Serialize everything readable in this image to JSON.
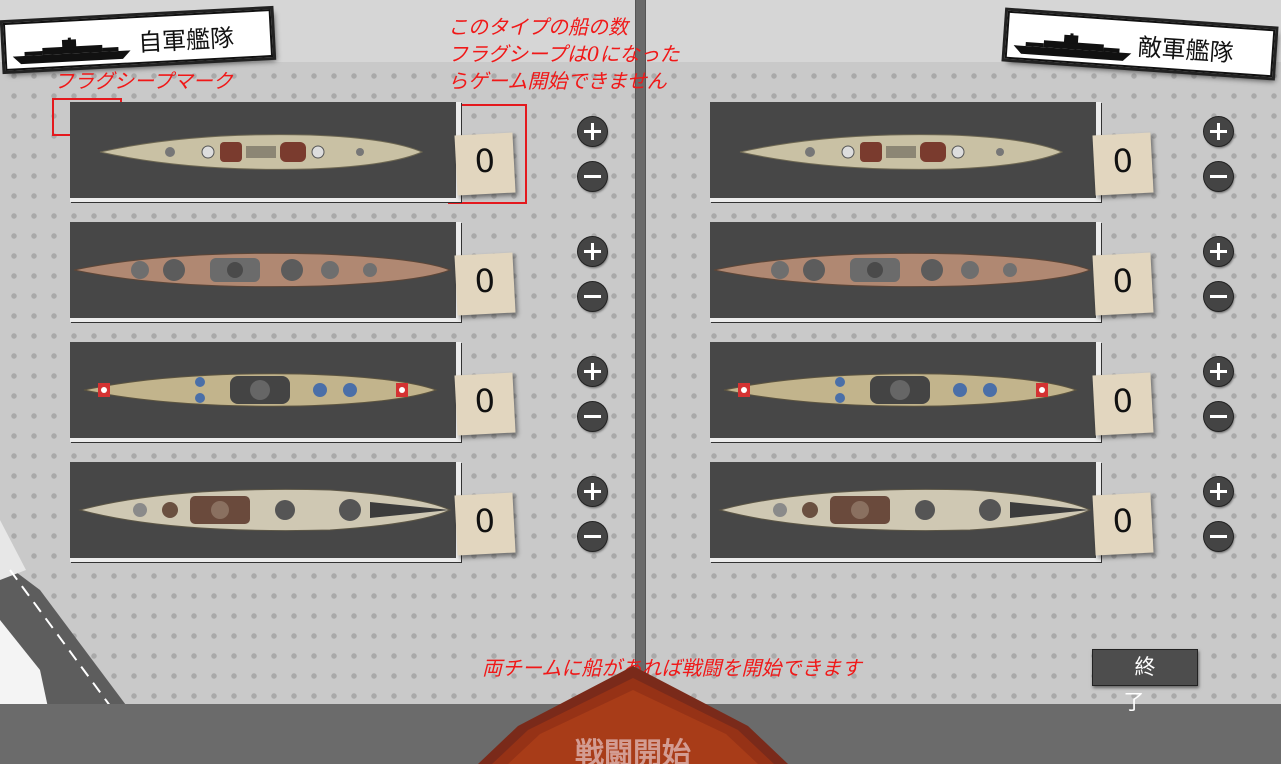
{
  "own_fleet": {
    "title": "自軍艦隊"
  },
  "enemy_fleet": {
    "title": "敵軍艦隊"
  },
  "annotations": {
    "flagship_mark": "フラグシープマーク",
    "count_note": [
      "このタイプの船の数",
      "フラグシープは0になった",
      "らゲーム開始できません"
    ],
    "start_note": "両チームに船があれば戦闘を開始できます"
  },
  "rows": [
    {
      "own_count": "0",
      "enemy_count": "0"
    },
    {
      "own_count": "0",
      "enemy_count": "0"
    },
    {
      "own_count": "0",
      "enemy_count": "0"
    },
    {
      "own_count": "0",
      "enemy_count": "0"
    }
  ],
  "buttons": {
    "end": "終了",
    "start": "戦闘開始"
  },
  "icons": {
    "plus": "plus-icon",
    "minus": "minus-icon",
    "flag": "flag-icon"
  },
  "colors": {
    "annotation": "#f01818",
    "count_card": "#e2d6bf",
    "card_bg": "#474747"
  }
}
